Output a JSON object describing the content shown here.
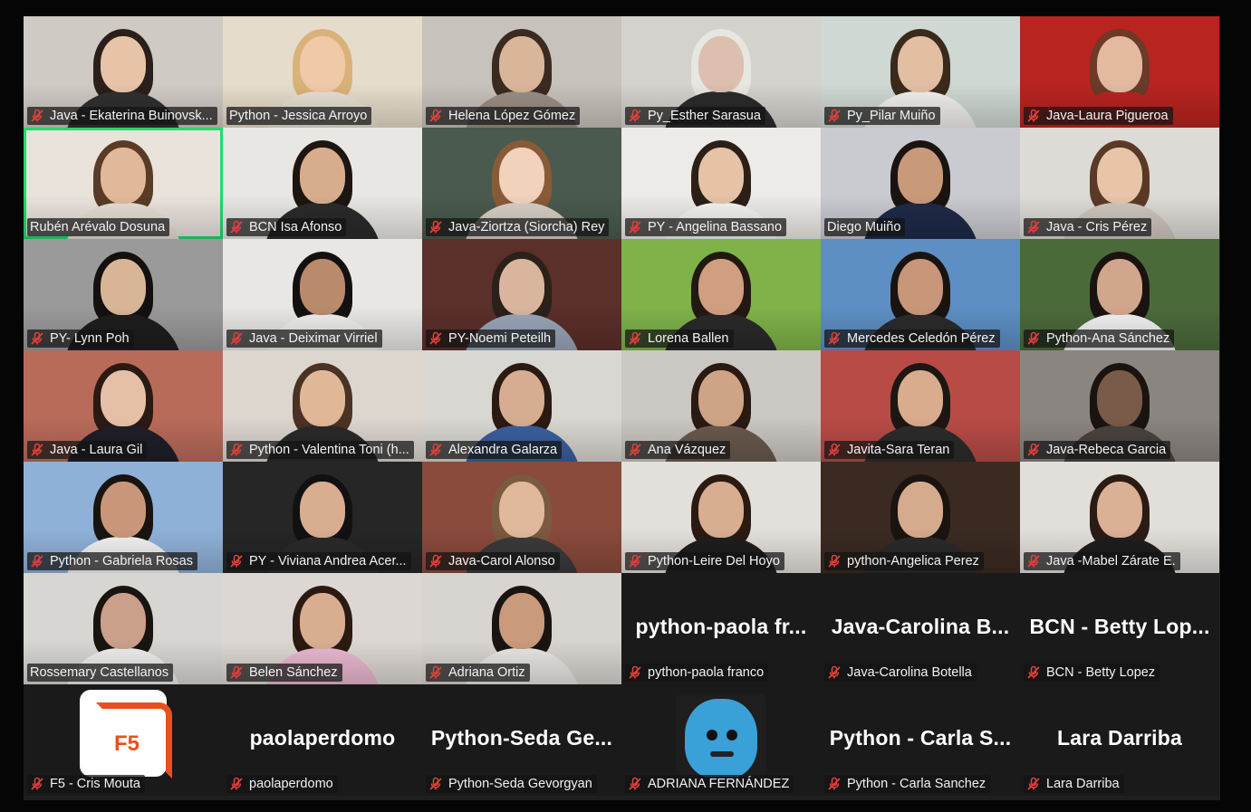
{
  "meeting": {
    "participants": [
      {
        "name": "Java - Ekaterina Buinovsk...",
        "muted": true,
        "bg": "#cfcac4",
        "skin": "#e7c3a8",
        "hair": "#2a1f1a",
        "shirt": "#303030"
      },
      {
        "name": "Python - Jessica Arroyo",
        "muted": false,
        "bg": "#e6dccb",
        "skin": "#f0c9a8",
        "hair": "#d9b27a",
        "shirt": "#e8e0d4"
      },
      {
        "name": "Helena López Gómez",
        "muted": true,
        "bg": "#c7c2bb",
        "skin": "#d9b59a",
        "hair": "#3a2a20",
        "shirt": "#9a8f86"
      },
      {
        "name": "Py_Esther Sarasua",
        "muted": true,
        "bg": "#d4d2cd",
        "skin": "#dcbfae",
        "hair": "#e8e6e0",
        "shirt": "#2b2b2b"
      },
      {
        "name": "Py_Pilar Muiño",
        "muted": true,
        "bg": "#cfd8d2",
        "skin": "#e2bea3",
        "hair": "#3a2a1c",
        "shirt": "#f2f0ec"
      },
      {
        "name": "Java-Laura Pigueroa",
        "muted": true,
        "bg": "#b8241f",
        "skin": "#e3b9a0",
        "hair": "#6b3a28",
        "shirt": "#b8241f"
      },
      {
        "name": "Rubén Arévalo Dosuna",
        "muted": false,
        "bg": "#e9e3dc",
        "skin": "#e2b89a",
        "hair": "#5a3b25",
        "shirt": "#e6dfd6",
        "active": true
      },
      {
        "name": "BCN Isa Afonso",
        "muted": true,
        "bg": "#e9e7e4",
        "skin": "#d8ad8e",
        "hair": "#1e1510",
        "shirt": "#2b2b2b"
      },
      {
        "name": "Java-Ziortza (Siorcha) Rey",
        "muted": true,
        "bg": "#4a5a4e",
        "skin": "#f0d2bd",
        "hair": "#8a5a36",
        "shirt": "#d7d0c6"
      },
      {
        "name": "PY - Angelina Bassano",
        "muted": true,
        "bg": "#ecebe8",
        "skin": "#e6c2a6",
        "hair": "#2c1f18",
        "shirt": "#f4f4f2"
      },
      {
        "name": "Diego Muiño",
        "muted": false,
        "bg": "#c9cbd0",
        "skin": "#c99a7a",
        "hair": "#1a1410",
        "shirt": "#1f2a48"
      },
      {
        "name": "Java - Cris Pérez",
        "muted": true,
        "bg": "#dedbd6",
        "skin": "#e8c4a8",
        "hair": "#5a3a26",
        "shirt": "#cfc8c0"
      },
      {
        "name": "PY- Lynn Poh",
        "muted": true,
        "bg": "#9a9a9a",
        "skin": "#d8b596",
        "hair": "#141010",
        "shirt": "#1e1e1e"
      },
      {
        "name": "Java - Deiximar Virriel",
        "muted": true,
        "bg": "#e9e7e5",
        "skin": "#b98a6c",
        "hair": "#141010",
        "shirt": "#f0eeec"
      },
      {
        "name": "PY-Noemi Peteilh",
        "muted": true,
        "bg": "#5b2f2a",
        "skin": "#d9b59d",
        "hair": "#2b201a",
        "shirt": "#9aa6b8"
      },
      {
        "name": "Lorena Ballen",
        "muted": true,
        "bg": "#7fb34a",
        "skin": "#cf9f80",
        "hair": "#241812",
        "shirt": "#2a2a2a"
      },
      {
        "name": "Mercedes Celedón Pérez",
        "muted": true,
        "bg": "#5d8fc4",
        "skin": "#c8977a",
        "hair": "#1a1410",
        "shirt": "#2b2b2b"
      },
      {
        "name": "Python-Ana Sánchez",
        "muted": true,
        "bg": "#4b6a3a",
        "skin": "#d1a68c",
        "hair": "#1a1410",
        "shirt": "#f2f2f2"
      },
      {
        "name": "Java - Laura Gil",
        "muted": true,
        "bg": "#b96b5a",
        "skin": "#e6c0a6",
        "hair": "#2a1a14",
        "shirt": "#1f1f2a"
      },
      {
        "name": "Python - Valentina Toni (h...",
        "muted": true,
        "bg": "#dcd6cf",
        "skin": "#e0b898",
        "hair": "#4a3224",
        "shirt": "#2a2a2a"
      },
      {
        "name": "Alexandra Galarza",
        "muted": true,
        "bg": "#d9d7d2",
        "skin": "#d6ad90",
        "hair": "#2a1a12",
        "shirt": "#3b5fa0"
      },
      {
        "name": "Ana Vázquez",
        "muted": true,
        "bg": "#cbc7c2",
        "skin": "#cfa486",
        "hair": "#2a1a12",
        "shirt": "#6a5a4e"
      },
      {
        "name": "Javita-Sara Teran",
        "muted": true,
        "bg": "#b84b46",
        "skin": "#d8ac8c",
        "hair": "#1e1612",
        "shirt": "#2c2c2c"
      },
      {
        "name": "Java-Rebeca Garcia",
        "muted": true,
        "bg": "#8a8580",
        "skin": "#7a5a48",
        "hair": "#1a1410",
        "shirt": "#4a4440"
      },
      {
        "name": "Python - Gabriela Rosas",
        "muted": true,
        "bg": "#8fb1d8",
        "skin": "#c9967a",
        "hair": "#1a1410",
        "shirt": "#f2f2f2"
      },
      {
        "name": "PY - Viviana Andrea Acer...",
        "muted": true,
        "bg": "#262626",
        "skin": "#d9ad90",
        "hair": "#111111",
        "shirt": "#2a2a2a"
      },
      {
        "name": "Java-Carol Alonso",
        "muted": true,
        "bg": "#8a4a3c",
        "skin": "#e0b89c",
        "hair": "#7a5a40",
        "shirt": "#3a3a3a"
      },
      {
        "name": "Python-Leire Del Hoyo",
        "muted": true,
        "bg": "#e3dfda",
        "skin": "#d9ae90",
        "hair": "#2a1a12",
        "shirt": "#1e1e1e"
      },
      {
        "name": "python-Angelica Perez",
        "muted": true,
        "bg": "#3a2a22",
        "skin": "#d6aa8c",
        "hair": "#1a1410",
        "shirt": "#2a2a2a"
      },
      {
        "name": "Java -Mabel Zárate E.",
        "muted": true,
        "bg": "#e2dfdb",
        "skin": "#dcb094",
        "hair": "#2a1c14",
        "shirt": "#1e1e1e"
      },
      {
        "name": "Rossemary Castellanos",
        "muted": false,
        "bg": "#d8d6d3",
        "skin": "#caa08a",
        "hair": "#1a1410",
        "shirt": "#f0eeec"
      },
      {
        "name": "Belen Sánchez",
        "muted": true,
        "bg": "#dcd7d2",
        "skin": "#d9ad90",
        "hair": "#2a1a12",
        "shirt": "#e9b8d0"
      },
      {
        "name": "Adriana Ortiz",
        "muted": true,
        "bg": "#d8d4cf",
        "skin": "#c99a7c",
        "hair": "#1a1410",
        "shirt": "#e8e6e2"
      },
      {
        "name": "python-paola franco",
        "muted": true,
        "display": "python-paola fr..."
      },
      {
        "name": "Java-Carolina Botella",
        "muted": true,
        "display": "Java-Carolina B..."
      },
      {
        "name": "BCN - Betty Lopez",
        "muted": true,
        "display": "BCN - Betty Lop..."
      },
      {
        "name": "F5 - Cris Mouta",
        "muted": true,
        "avatar": "f5",
        "avatar_text": "F5"
      },
      {
        "name": "paolaperdomo",
        "muted": true,
        "display": "paolaperdomo"
      },
      {
        "name": "Python-Seda Gevorgyan",
        "muted": true,
        "display": "Python-Seda Ge..."
      },
      {
        "name": "ADRIANA FERNÁNDEZ",
        "muted": true,
        "avatar": "blue"
      },
      {
        "name": "Python - Carla Sanchez",
        "muted": true,
        "display": "Python - Carla S..."
      },
      {
        "name": "Lara Darriba",
        "muted": true,
        "display": "Lara Darriba"
      }
    ]
  },
  "colors": {
    "active_speaker_border": "#23d96b",
    "mute_icon": "#e0413a",
    "stage_bg": "#1f1f1f"
  }
}
